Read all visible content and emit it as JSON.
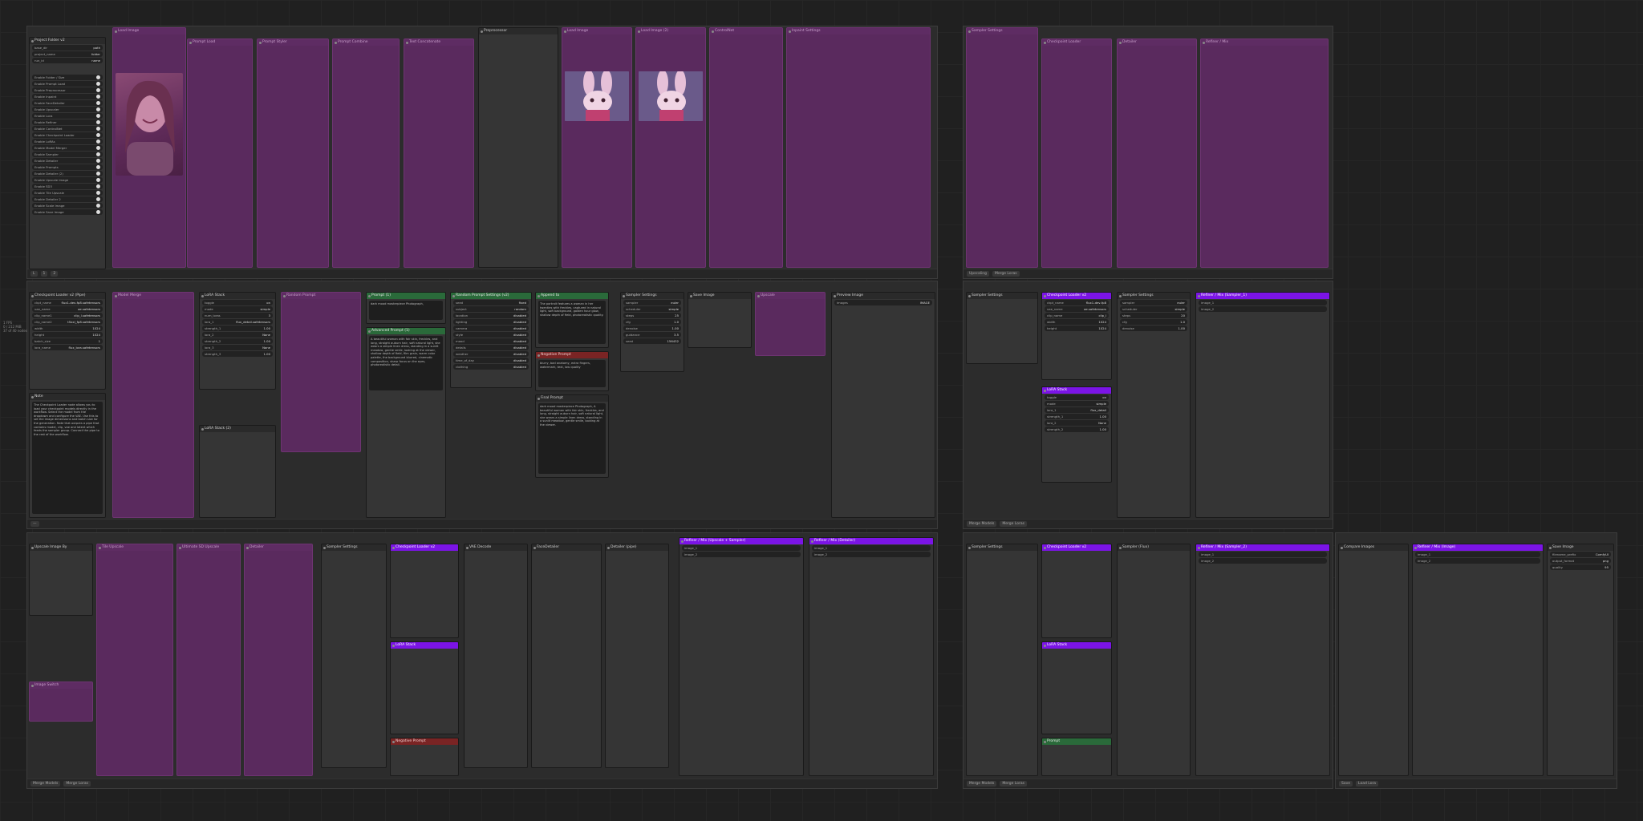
{
  "canvas": {
    "title": "ComfyUI workflow canvas",
    "zoom_info": [
      "1 FPS",
      "0 / 212 MiB",
      "37 of 40 nodes"
    ]
  },
  "group_bars": {
    "g1": [
      "L",
      "1",
      "2",
      "10",
      "10"
    ],
    "g2": [
      "Upscaling",
      "fix",
      "Merge Loras"
    ],
    "g5": [
      "Merge Models",
      "Merge Loras"
    ],
    "g6": [
      "Merge Models",
      "Merge Loras"
    ],
    "g7": [
      "Merge Models",
      "Merge Loras"
    ],
    "g8": [
      "Merge Models",
      "Merge Loras"
    ],
    "g9": [
      "Save",
      "Load Lora"
    ]
  },
  "nodes": {
    "project_folder": {
      "title": "Project Folder v2",
      "rows": [
        [
          "base_dir",
          "path"
        ],
        [
          "project_name",
          "folder"
        ],
        [
          "run_id",
          "name"
        ]
      ],
      "toggles": [
        "Enable Folder / Size",
        "Enable Prompt Load",
        "Enable Preprocessor",
        "Enable Inpaint",
        "Enable FaceDetailer",
        "Enable Upscaler",
        "Enable Lora",
        "Enable Refiner",
        "Enable ControlNet",
        "Enable Checkpoint Loader",
        "Enable LoRAs",
        "Enable Model Merger",
        "Enable Sampler",
        "Enable Detailer",
        "Enable Prompts",
        "Enable Detailer (2)",
        "Enable Upscale Image",
        "Enable SD3",
        "Enable Tile Upscale",
        "Enable Detailer 2",
        "Enable Scale Image",
        "Enable Save Image"
      ]
    },
    "checkpoint_loader": {
      "title": "Checkpoint Loader v2 (Pipe)",
      "rows": [
        [
          "ckpt_name",
          "flux1-dev-fp8.safetensors"
        ],
        [
          "vae_name",
          "ae.safetensors"
        ],
        [
          "clip_name1",
          "clip_l.safetensors"
        ],
        [
          "clip_name2",
          "t5xxl_fp8.safetensors"
        ],
        [
          "width",
          "1024"
        ],
        [
          "height",
          "1024"
        ],
        [
          "batch_size",
          "1"
        ],
        [
          "lora_name",
          "flux_lora.safetensors"
        ]
      ]
    },
    "note_main": {
      "title": "Note",
      "text": "The Checkpoint Loader node allows you to load your checkpoint models directly in the workflow. Select the model from the dropdown and configure the VAE. Use this to set the image dimensions and batch size for the generation. Note that outputs a pipe that contains model, clip, vae and latent which feeds the sampler group. Connect the pipe to the rest of the workflow."
    },
    "lora_stack_1": {
      "title": "LoRA Stack",
      "rows": [
        [
          "toggle",
          "on"
        ],
        [
          "mode",
          "simple"
        ],
        [
          "num_loras",
          "3"
        ],
        [
          "lora_1",
          "flux_detail.safetensors"
        ],
        [
          "strength_1",
          "1.00"
        ],
        [
          "lora_2",
          "None"
        ],
        [
          "strength_2",
          "1.00"
        ],
        [
          "lora_3",
          "None"
        ],
        [
          "strength_3",
          "1.00"
        ]
      ]
    },
    "prompt_1": {
      "title": "Prompt (1)",
      "text": "dark mood masterpiece Photograph,"
    },
    "enhanced_prompt": {
      "title": "Advanced Prompt (1)",
      "text": "A beautiful woman with fair skin, freckles, and long, straight auburn hair, soft natural light, she wears a simple linen dress, standing in a sunlit meadow, gentle smile, looking at the viewer, shallow depth of field, film grain, warm color palette, the background blurred, cinematic composition, sharp focus on the eyes, photorealistic detail."
    },
    "random_prompt": {
      "title": "Random Prompt Settings (v2)",
      "rows": [
        [
          "seed",
          "fixed"
        ],
        [
          "subject",
          "random"
        ],
        [
          "location",
          "disabled"
        ],
        [
          "lighting",
          "disabled"
        ],
        [
          "camera",
          "disabled"
        ],
        [
          "style",
          "disabled"
        ],
        [
          "mood",
          "disabled"
        ],
        [
          "details",
          "disabled"
        ],
        [
          "weather",
          "disabled"
        ],
        [
          "time_of_day",
          "disabled"
        ],
        [
          "clothing",
          "disabled"
        ]
      ]
    },
    "append_node": {
      "title": "Append to",
      "text": "The portrait features a woman in her twenties with freckles, captured in natural light, soft background, golden hour glow, shallow depth of field, photorealistic quality."
    },
    "negative_prompt_1": {
      "title": "Negative Prompt",
      "text": "blurry, bad anatomy, extra fingers, watermark, text, low quality"
    },
    "final_prompt": {
      "title": "Final Prompt",
      "text": "dark mood masterpiece Photograph, A beautiful woman with fair skin, freckles, and long, straight auburn hair, soft natural light, she wears a simple linen dress, standing in a sunlit meadow, gentle smile, looking at the viewer."
    },
    "sampler_settings": {
      "title": "Sampler Settings",
      "rows": [
        [
          "sampler",
          "euler"
        ],
        [
          "scheduler",
          "simple"
        ],
        [
          "steps",
          "25"
        ],
        [
          "cfg",
          "1.0"
        ],
        [
          "denoise",
          "1.00"
        ],
        [
          "guidance",
          "3.5"
        ],
        [
          "seed",
          "156432"
        ]
      ]
    },
    "preview_image": {
      "title": "Preview Image",
      "rows": [
        [
          "images",
          "IMAGE"
        ]
      ]
    },
    "refiner_1": {
      "title": "Refiner / Mix (Sampler_1)",
      "rows": [
        [
          "image_1",
          ""
        ],
        [
          "image_2",
          ""
        ]
      ]
    },
    "checkpoint_loader_2": {
      "title": "Checkpoint Loader v2",
      "rows": [
        [
          "ckpt_name",
          "flux1-dev-fp8"
        ],
        [
          "vae_name",
          "ae.safetensors"
        ],
        [
          "clip_name",
          "clip_l"
        ],
        [
          "width",
          "1024"
        ],
        [
          "height",
          "1024"
        ]
      ]
    },
    "lora_stack_2": {
      "title": "LoRA Stack",
      "rows": [
        [
          "toggle",
          "on"
        ],
        [
          "mode",
          "simple"
        ],
        [
          "lora_1",
          "flux_detail"
        ],
        [
          "strength_1",
          "1.00"
        ],
        [
          "lora_2",
          "None"
        ],
        [
          "strength_2",
          "1.00"
        ]
      ]
    },
    "flux_sampler": {
      "title": "Sampler Settings",
      "rows": [
        [
          "sampler",
          "euler"
        ],
        [
          "scheduler",
          "simple"
        ],
        [
          "steps",
          "20"
        ],
        [
          "cfg",
          "1.0"
        ],
        [
          "denoise",
          "1.00"
        ]
      ]
    },
    "upscale_mix": {
      "title": "Refiner / Mix (Upscale + Sampler)",
      "rows": [
        [
          "image_1",
          ""
        ],
        [
          "image_2",
          ""
        ]
      ]
    },
    "refiner_detail": {
      "title": "Refiner / Mix (Detailer)",
      "rows": [
        [
          "image_1",
          ""
        ],
        [
          "image_2",
          ""
        ]
      ]
    },
    "refiner_3": {
      "title": "Refiner / Mix (Sampler_2)",
      "rows": [
        [
          "image_1",
          ""
        ],
        [
          "image_2",
          ""
        ]
      ]
    },
    "refiner_4": {
      "title": "Refiner / Mix (Image)",
      "rows": [
        [
          "image_1",
          ""
        ],
        [
          "image_2",
          ""
        ]
      ]
    },
    "save_image": {
      "title": "Save Image",
      "rows": [
        [
          "filename_prefix",
          "ComfyUI"
        ],
        [
          "output_format",
          "png"
        ],
        [
          "quality",
          "95"
        ]
      ]
    }
  }
}
